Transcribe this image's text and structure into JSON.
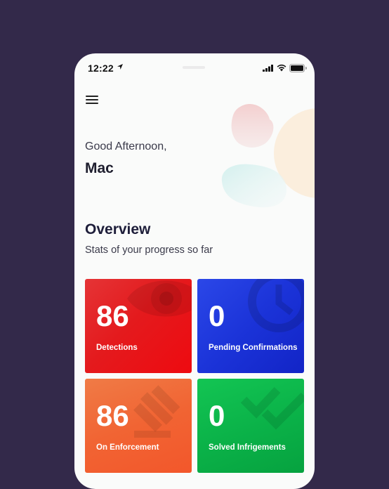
{
  "status_bar": {
    "time": "12:22"
  },
  "greeting": {
    "line": "Good Afternoon,",
    "name": "Mac"
  },
  "overview": {
    "title": "Overview",
    "subtitle": "Stats of your progress so far"
  },
  "cards": [
    {
      "value": "86",
      "label": "Detections",
      "color": "#e41a1d",
      "icon": "eye-icon"
    },
    {
      "value": "0",
      "label": "Pending Confirmations",
      "color": "#1b33d8",
      "icon": "clock-icon"
    },
    {
      "value": "86",
      "label": "On Enforcement",
      "color": "#f16433",
      "icon": "gavel-icon"
    },
    {
      "value": "0",
      "label": "Solved Infrigements",
      "color": "#0bb349",
      "icon": "double-check-icon"
    }
  ],
  "colors": {
    "background": "#33294a",
    "screen": "#fafbfa",
    "text_dark": "#1e1e2e"
  }
}
